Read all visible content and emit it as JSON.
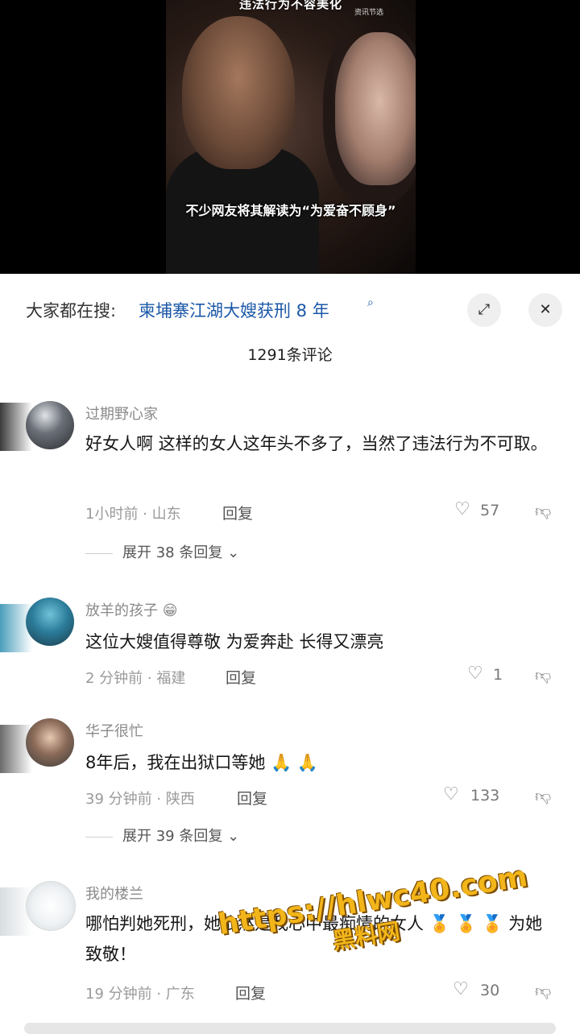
{
  "video": {
    "top_subtitle": "违法行为不容美化",
    "small_watermark": "资讯节选",
    "caption": "不少网友将其解读为“为爱奋不顾身”"
  },
  "search": {
    "prefix": "大家都在搜:",
    "term": "柬埔寨江湖大嫂获刑 8 年",
    "mag_icon": "search-icon",
    "expand_icon": "expand-icon",
    "close_icon": "close-icon"
  },
  "comments_header": {
    "count_label": "1291条评论"
  },
  "comments": [
    {
      "username": "过期野心家",
      "text": "好女人啊 这样的女人这年头不多了，当然了违法行为不可取。",
      "time_location": "1小时前 · 山东",
      "reply_label": "回复",
      "likes": "57",
      "expand_label": "展开 38 条回复"
    },
    {
      "username": "放羊的孩子",
      "username_emoji": "😁",
      "text": "这位大嫂值得尊敬 为爱奔赴 长得又漂亮",
      "time_location": "2 分钟前 · 福建",
      "reply_label": "回复",
      "likes": "1"
    },
    {
      "username": "华子很忙",
      "text": "8年后，我在出狱口等她 🙏 🙏",
      "time_location": "39 分钟前 · 陕西",
      "reply_label": "回复",
      "likes": "133",
      "expand_label": "展开 39 条回复"
    },
    {
      "username": "我的楼兰",
      "text": "哪怕判她死刑，她依然是我心中最痴情的女人 🏅 🏅 🏅 为她致敬！",
      "time_location": "19 分钟前 · 广东",
      "reply_label": "回复",
      "likes": "30"
    }
  ],
  "overlay_watermark": {
    "url": "https://hlwc40.com",
    "site_name": "黑料网"
  },
  "colors": {
    "link_blue": "#1b58a8",
    "watermark_gold": "#f2b51a",
    "meta_gray": "#9a9a9a"
  }
}
